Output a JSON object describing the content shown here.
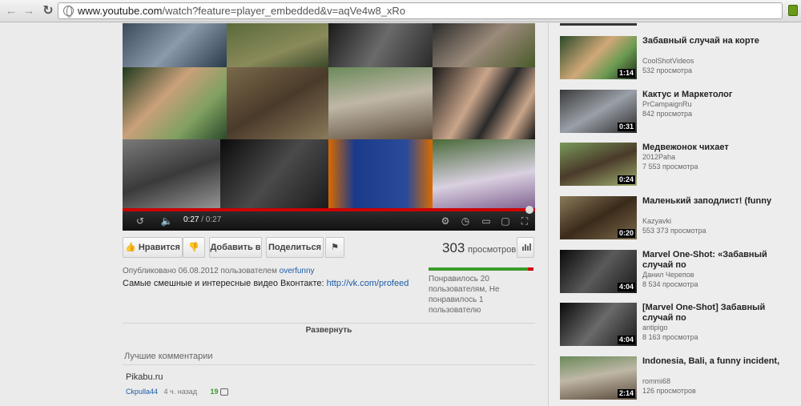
{
  "browser": {
    "url_host": "www.youtube.com",
    "url_path": "/watch?feature=player_embedded&v=aqVe4w8_xRo"
  },
  "player": {
    "time_current": "0:27",
    "time_total": "/ 0:27",
    "progress": 1.0
  },
  "actions": {
    "like_label": "Нравится",
    "add_label": "Добавить в",
    "share_label": "Поделиться"
  },
  "stats": {
    "view_count": "303",
    "view_label": "просмотров",
    "like_ratio": 0.95,
    "likes_text": "Понравилось 20 пользователям, Не понравилось 1 пользователю"
  },
  "info": {
    "published_prefix": "Опубликовано 06.08.2012 пользователем",
    "publisher": "overfunny",
    "description_text": "Самые смешные и интересные видео Вконтакте:",
    "description_link": "http://vk.com/profeed",
    "expand_label": "Развернуть"
  },
  "comments": {
    "header": "Лучшие комментарии",
    "items": [
      {
        "text": "Pikabu.ru",
        "author": "Ckpulla44",
        "time": "4 ч. назад",
        "likes": "19"
      }
    ]
  },
  "related": [
    {
      "title": "Забавный случай на корте",
      "author": "CoolShotVideos",
      "views": "532 просмотра",
      "duration": "1:14"
    },
    {
      "title": "Кактус и Маркетолог",
      "author": "PrCampaignRu",
      "views": "842 просмотра",
      "duration": "0:31"
    },
    {
      "title": "Медвежонок чихает",
      "author": "2012Paha",
      "views": "7 553 просмотра",
      "duration": "0:24"
    },
    {
      "title": "Маленький заподлист! (funny",
      "author": "Kazyavki",
      "views": "553 373 просмотра",
      "duration": "0:20"
    },
    {
      "title": "Marvel One-Shot: «Забавный случай по",
      "author": "Данил Черепов",
      "views": "8 534 просмотра",
      "duration": "4:04"
    },
    {
      "title": "[Marvel One-Shot] Забавный случай по",
      "author": "antipigo",
      "views": "8 163 просмотра",
      "duration": "4:04"
    },
    {
      "title": "Indonesia, Bali, a funny incident,",
      "author": "rommi68",
      "views": "126 просмотров",
      "duration": "2:14"
    }
  ],
  "colors": {
    "progress_red": "#cc0000",
    "link_blue": "#1b5ba8",
    "like_green": "#3c9a2c"
  }
}
